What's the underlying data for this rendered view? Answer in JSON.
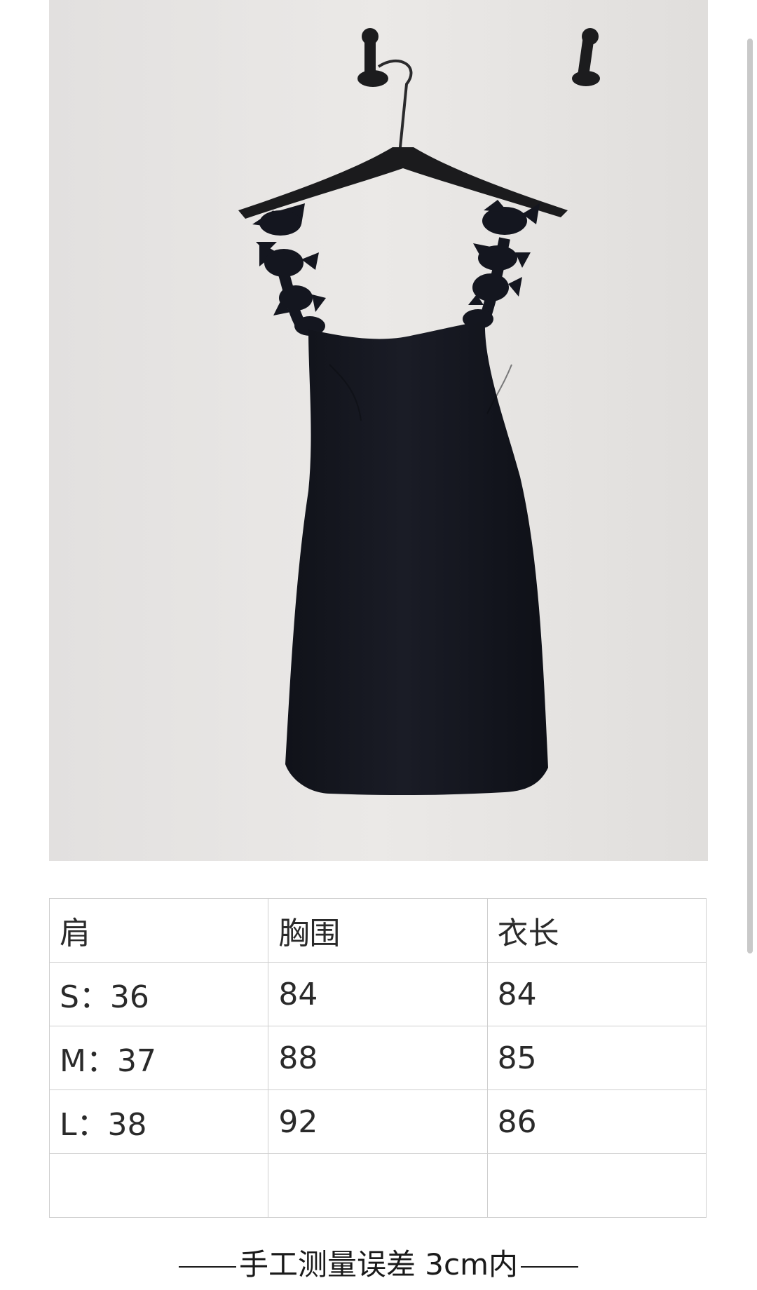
{
  "photo": {
    "subject": "black sleeveless dress with bow straps on hanger",
    "colors": {
      "wall": "#e6e4e2",
      "dress": "#14161f",
      "hanger": "#1b1b1d"
    }
  },
  "size_table": {
    "header": [
      "肩",
      "胸围",
      "衣长"
    ],
    "rows": [
      [
        "S：36",
        "84",
        "84"
      ],
      [
        "M：37",
        "88",
        "85"
      ],
      [
        "L：38",
        "92",
        "86"
      ],
      [
        "",
        "",
        ""
      ]
    ]
  },
  "note": {
    "text": "手工测量误差 3cm内"
  }
}
